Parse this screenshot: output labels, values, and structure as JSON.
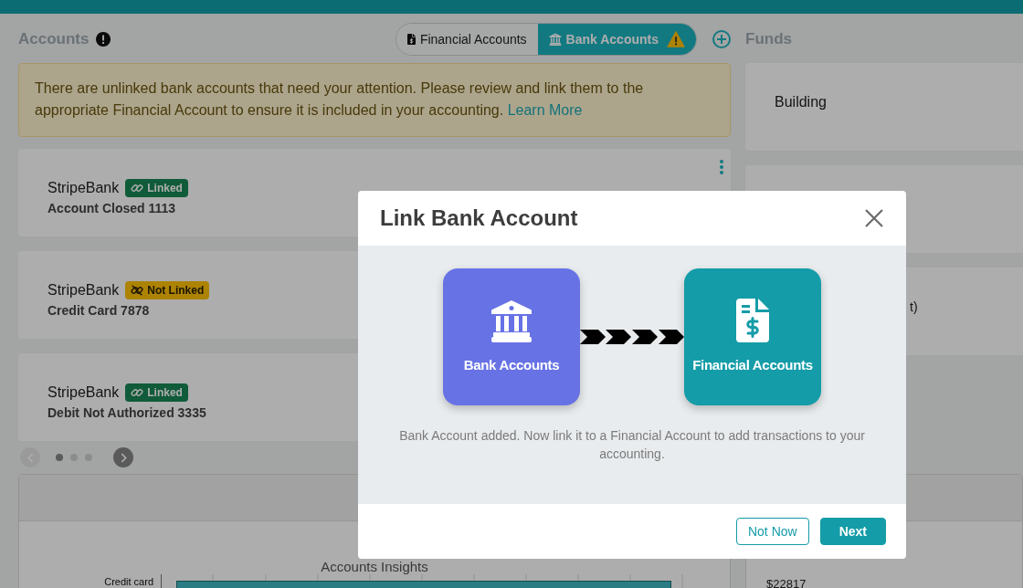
{
  "accounts": {
    "title": "Accounts",
    "view_toggle": [
      {
        "label": "Financial Accounts",
        "kind": "financial",
        "selected": false,
        "warning": false
      },
      {
        "label": "Bank Accounts",
        "kind": "bank",
        "selected": true,
        "warning": true
      }
    ],
    "alert": {
      "message": "There are unlinked bank accounts that need your attention. Please review and link them to the appropriate Financial Account to ensure it is included in your accounting.",
      "link": "Learn More"
    },
    "cards": [
      {
        "bank": "StripeBank",
        "status": "Linked",
        "linked": true,
        "name": "Account Closed 1113"
      },
      {
        "bank": "StripeBank",
        "status": "Not Linked",
        "linked": false,
        "name": "Credit Card 7878"
      },
      {
        "bank": "StripeBank",
        "status": "Linked",
        "linked": true,
        "name": "Debit Not Authorized 3335"
      }
    ],
    "carousel": {
      "prev_disabled": true,
      "next_disabled": false,
      "dots": [
        {
          "selected": true
        },
        {
          "selected": false
        },
        {
          "selected": false
        }
      ]
    },
    "insights": {
      "title": "Accounts Insights",
      "category": "Credit card"
    }
  },
  "funds": {
    "title": "Funds",
    "cards": [
      {
        "kind": "text",
        "text": "Building"
      },
      {
        "kind": "blank"
      },
      {
        "kind": "clipped",
        "text": "t)"
      }
    ],
    "insights": {
      "amount": "$22817"
    }
  },
  "modal": {
    "title": "Link Bank Account",
    "tiles": [
      {
        "label": "Bank Accounts",
        "kind": "bank",
        "color": "#6772e5"
      },
      {
        "label": "Financial Accounts",
        "kind": "financial",
        "color": "#149ca8"
      }
    ],
    "description": "Bank Account added. Now link it to a Financial Account to add transactions to your accounting.",
    "buttons": [
      {
        "label": "Not Now",
        "kind": "secondary"
      },
      {
        "label": "Next",
        "kind": "primary"
      }
    ]
  }
}
